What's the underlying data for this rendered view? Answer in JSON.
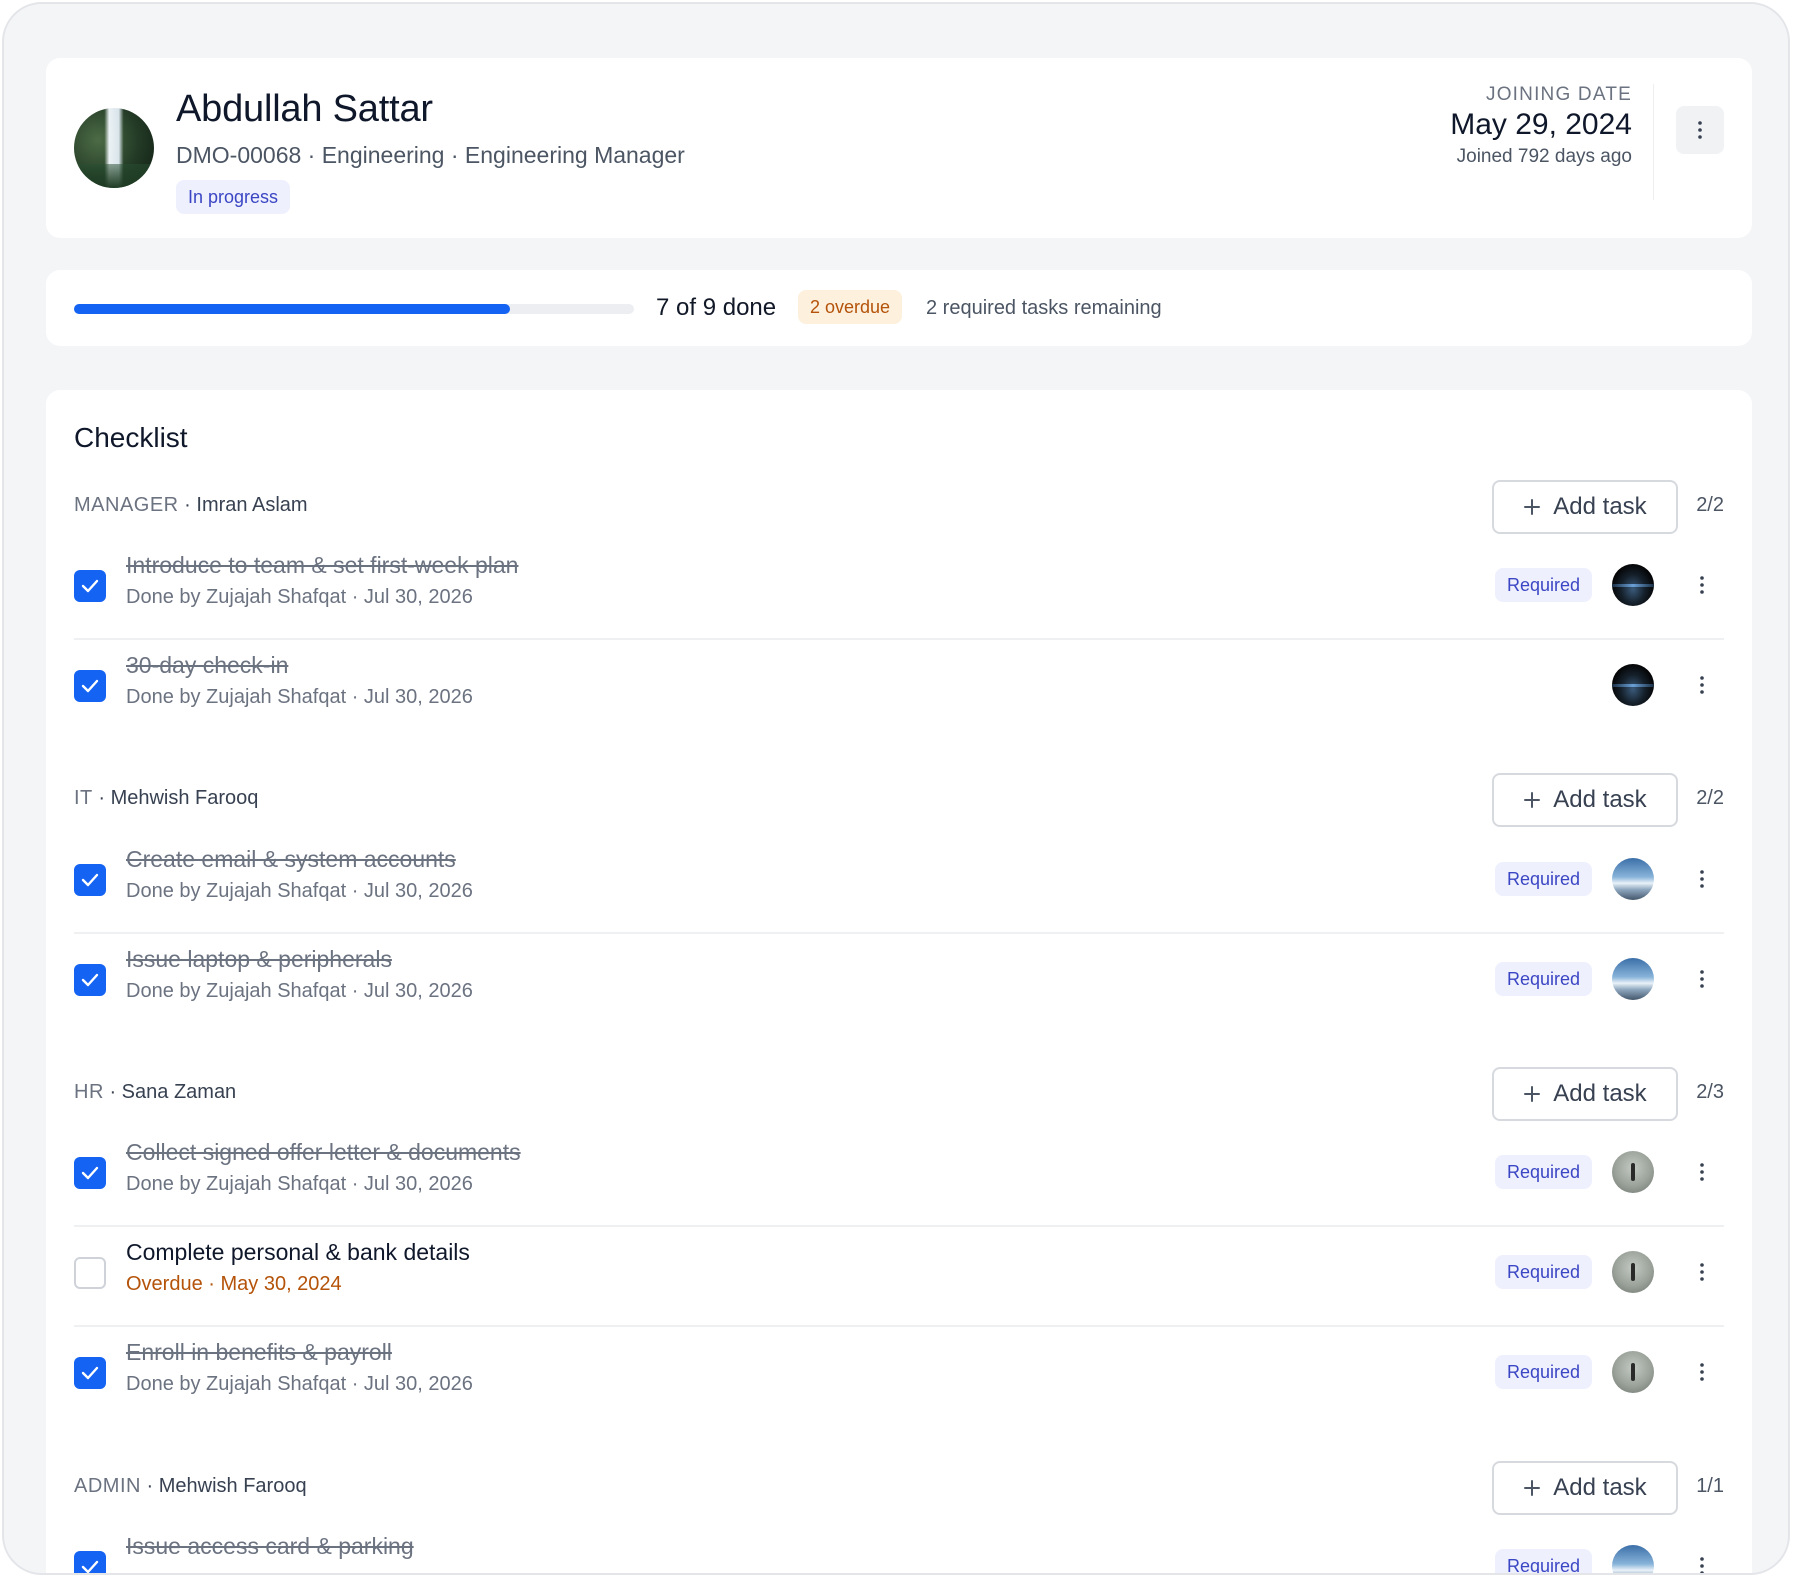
{
  "profile": {
    "name": "Abdullah Sattar",
    "meta": "DMO-00068 · Engineering · Engineering Manager",
    "status": "In progress",
    "joining_label": "JOINING DATE",
    "joining_date": "May 29, 2024",
    "joined_ago": "Joined 792 days ago"
  },
  "progress": {
    "done_fraction": 0.7778,
    "summary": "7 of 9 done",
    "overdue": "2 overdue",
    "remaining": "2 required tasks remaining"
  },
  "checklist": {
    "title": "Checklist",
    "add_task_label": "Add task",
    "groups": [
      {
        "role": "MANAGER",
        "separator": " · ",
        "owner": "Imran Aslam",
        "count": "2/2",
        "tasks": [
          {
            "title": "Introduce to team & set first-week plan",
            "subtitle": "Done by Zujajah Shafqat · Jul 30, 2026",
            "badge": "Required",
            "done": true
          },
          {
            "title": "30-day check-in",
            "subtitle": "Done by Zujajah Shafqat · Jul 30, 2026",
            "badge": "",
            "done": true
          }
        ]
      },
      {
        "role": "IT",
        "separator": " · ",
        "owner": "Mehwish Farooq",
        "count": "2/2",
        "tasks": [
          {
            "title": "Create email & system accounts",
            "subtitle": "Done by Zujajah Shafqat · Jul 30, 2026",
            "badge": "Required",
            "done": true
          },
          {
            "title": "Issue laptop & peripherals",
            "subtitle": "Done by Zujajah Shafqat · Jul 30, 2026",
            "badge": "Required",
            "done": true
          }
        ]
      },
      {
        "role": "HR",
        "separator": " · ",
        "owner": "Sana Zaman",
        "count": "2/3",
        "tasks": [
          {
            "title": "Collect signed offer letter & documents",
            "subtitle": "Done by Zujajah Shafqat · Jul 30, 2026",
            "badge": "Required",
            "done": true
          },
          {
            "title": "Complete personal & bank details",
            "subtitle": "Overdue · May 30, 2024",
            "badge": "Required",
            "done": false
          },
          {
            "title": "Enroll in benefits & payroll",
            "subtitle": "Done by Zujajah Shafqat · Jul 30, 2026",
            "badge": "Required",
            "done": true
          }
        ]
      },
      {
        "role": "ADMIN",
        "separator": " · ",
        "owner": "Mehwish Farooq",
        "count": "1/1",
        "tasks": [
          {
            "title": "Issue access card & parking",
            "subtitle": "",
            "badge": "Required",
            "done": true
          }
        ]
      }
    ]
  },
  "colors": {
    "accent": "#1463f3",
    "required_bg": "#eef0fd",
    "required_text": "#3b46c4",
    "overdue_bg": "#fdf0dd",
    "overdue_text": "#b45309"
  },
  "icons": {
    "check": "check-icon",
    "more": "more-vertical-icon",
    "plus": "plus-icon"
  }
}
